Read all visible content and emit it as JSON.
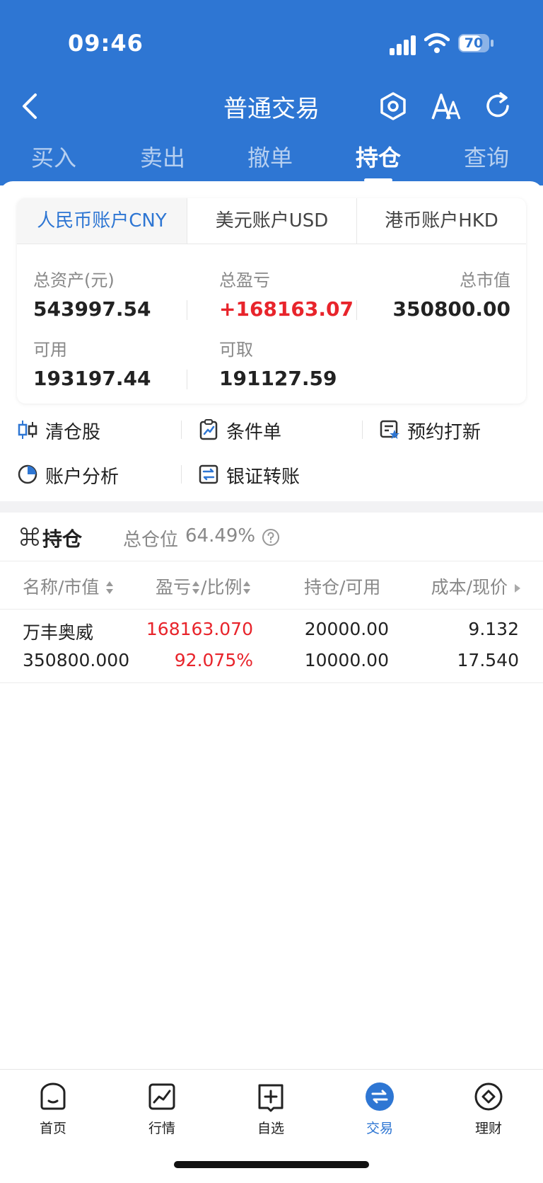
{
  "status_bar": {
    "time": "09:46",
    "battery": "70"
  },
  "nav": {
    "title": "普通交易"
  },
  "trade_tabs": [
    {
      "label": "买入"
    },
    {
      "label": "卖出"
    },
    {
      "label": "撤单"
    },
    {
      "label": "持仓"
    },
    {
      "label": "查询"
    }
  ],
  "accounts": [
    {
      "label": "人民币账户CNY"
    },
    {
      "label": "美元账户USD"
    },
    {
      "label": "港币账户HKD"
    }
  ],
  "summary": {
    "total_assets_label": "总资产(元)",
    "total_assets": "543997.54",
    "total_pl_label": "总盈亏",
    "total_pl": "+168163.07",
    "market_value_label": "总市值",
    "market_value": "350800.00",
    "available_label": "可用",
    "available": "193197.44",
    "withdrawable_label": "可取",
    "withdrawable": "191127.59"
  },
  "quick_actions": [
    {
      "label": "清仓股",
      "icon": "candlestick-icon"
    },
    {
      "label": "条件单",
      "icon": "clipboard-chart-icon"
    },
    {
      "label": "预约打新",
      "icon": "ipo-star-icon"
    },
    {
      "label": "账户分析",
      "icon": "pie-chart-icon"
    },
    {
      "label": "银证转账",
      "icon": "transfer-icon"
    }
  ],
  "holdings": {
    "title": "持仓",
    "position_label": "总仓位",
    "position_value": "64.49%",
    "columns": [
      "名称/市值",
      "盈亏",
      "/比例",
      "持仓/可用",
      "成本/现价"
    ],
    "rows": [
      {
        "name": "万丰奥威",
        "market_value": "350800.000",
        "pl": "168163.070",
        "pl_ratio": "92.075%",
        "position": "20000.00",
        "available": "10000.00",
        "cost": "9.132",
        "price": "17.540"
      }
    ]
  },
  "bottom_nav": [
    {
      "label": "首页"
    },
    {
      "label": "行情"
    },
    {
      "label": "自选"
    },
    {
      "label": "交易"
    },
    {
      "label": "理财"
    }
  ],
  "colors": {
    "brand": "#2e76d3",
    "up": "#e8242b"
  }
}
